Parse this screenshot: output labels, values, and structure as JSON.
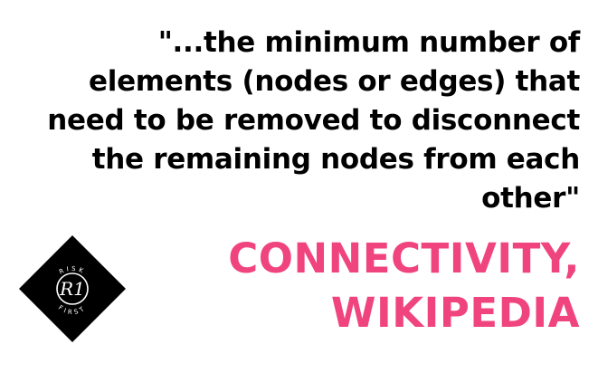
{
  "quote": {
    "lines": [
      "\"...the minimum number of",
      "elements (nodes or edges) that",
      "need to be removed to disconnect",
      "the remaining nodes from each",
      "other\""
    ]
  },
  "attribution": {
    "lines": [
      "CONNECTIVITY,",
      "WIKIPEDIA"
    ]
  },
  "logo": {
    "top_text": "RISK",
    "bottom_text": "FIRST",
    "monogram": "R1"
  },
  "colors": {
    "accent": "#f0447f",
    "text": "#000000",
    "logo_bg": "#000000",
    "logo_fg": "#ffffff"
  }
}
